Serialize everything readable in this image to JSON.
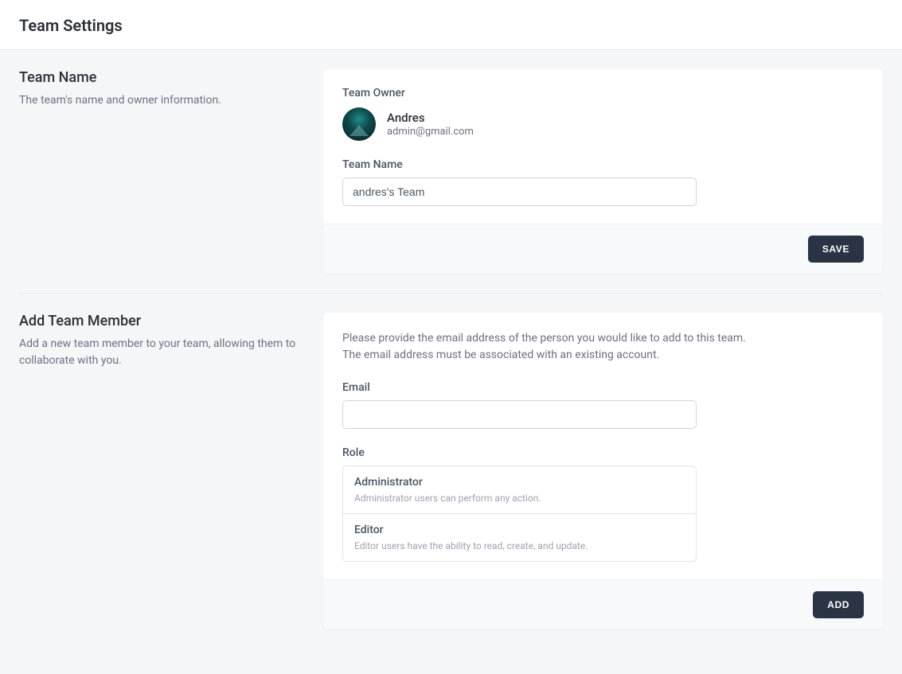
{
  "header": {
    "title": "Team Settings"
  },
  "team_name_section": {
    "title": "Team Name",
    "description": "The team's name and owner information.",
    "owner_label": "Team Owner",
    "owner": {
      "name": "Andres",
      "email": "admin@gmail.com"
    },
    "team_name_label": "Team Name",
    "team_name_value": "andres's Team",
    "save_button": "SAVE"
  },
  "add_member_section": {
    "title": "Add Team Member",
    "description": "Add a new team member to your team, allowing them to collaborate with you.",
    "info_text": "Please provide the email address of the person you would like to add to this team. The email address must be associated with an existing account.",
    "email_label": "Email",
    "email_value": "",
    "role_label": "Role",
    "roles": [
      {
        "name": "Administrator",
        "description": "Administrator users can perform any action."
      },
      {
        "name": "Editor",
        "description": "Editor users have the ability to read, create, and update."
      }
    ],
    "add_button": "ADD"
  }
}
